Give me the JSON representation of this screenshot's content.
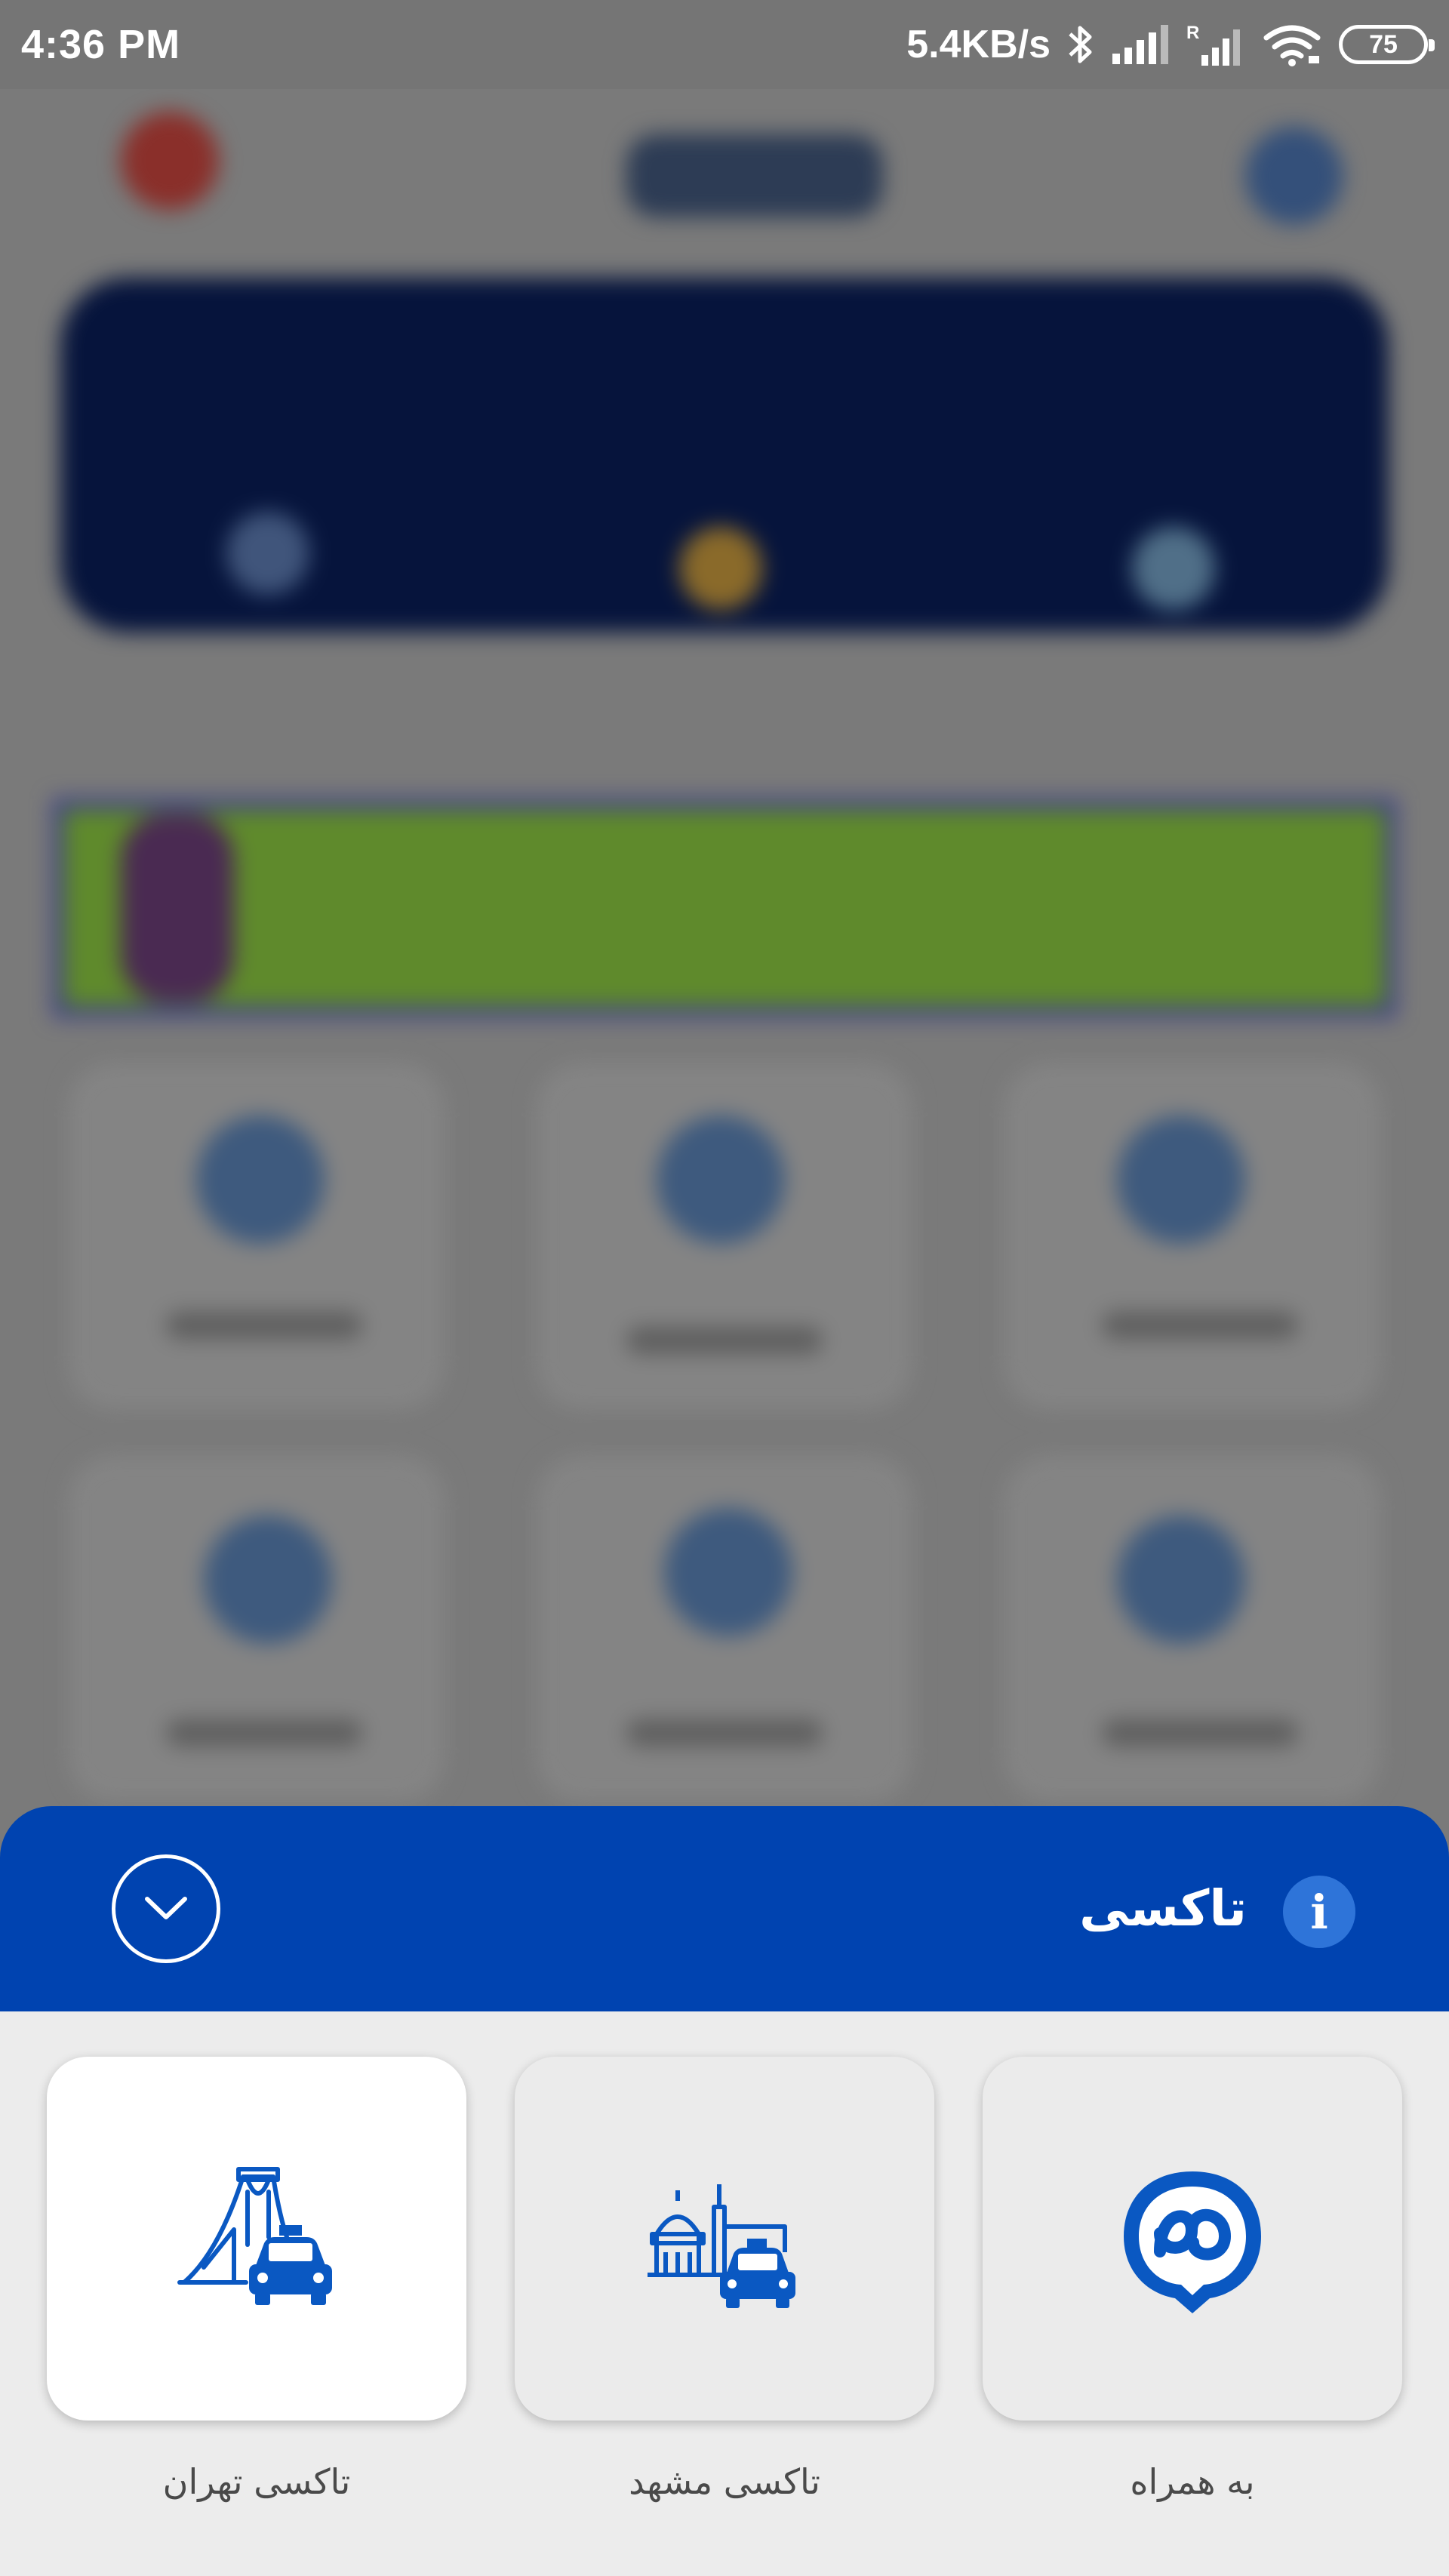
{
  "status_bar": {
    "time": "4:36 PM",
    "network_speed": "5.4KB/s",
    "battery_level": "75",
    "icons": [
      "bluetooth-icon",
      "signal-icon",
      "roaming-signal-icon",
      "wifi-icon",
      "battery-icon"
    ]
  },
  "sheet": {
    "title": "تاکسی",
    "info_icon": "i",
    "collapse_icon": "chevron-down-icon",
    "accent_color": "#0043b0"
  },
  "services": [
    {
      "label": "به همراه",
      "icon": "behamrah-logo-icon"
    },
    {
      "label": "تاکسی مشهد",
      "icon": "mashhad-taxi-icon"
    },
    {
      "label": "تاکسی تهران",
      "icon": "tehran-taxi-icon",
      "selected": true
    }
  ]
}
